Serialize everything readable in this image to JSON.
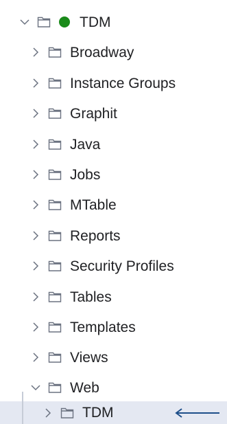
{
  "colors": {
    "status_green": "#1a8a1a",
    "icon_gray": "#6b7280",
    "selected_bg": "#e4e8f2",
    "arrow_blue": "#1d4e89"
  },
  "tree": {
    "root": {
      "label": "TDM",
      "expanded": true,
      "status_color": "#1a8a1a"
    },
    "children": [
      {
        "label": "Broadway",
        "expanded": false
      },
      {
        "label": "Instance Groups",
        "expanded": false
      },
      {
        "label": "Graphit",
        "expanded": false
      },
      {
        "label": "Java",
        "expanded": false
      },
      {
        "label": "Jobs",
        "expanded": false
      },
      {
        "label": "MTable",
        "expanded": false
      },
      {
        "label": "Reports",
        "expanded": false
      },
      {
        "label": "Security Profiles",
        "expanded": false
      },
      {
        "label": "Tables",
        "expanded": false
      },
      {
        "label": "Templates",
        "expanded": false
      },
      {
        "label": "Views",
        "expanded": false
      },
      {
        "label": "Web",
        "expanded": true
      }
    ],
    "web_child": {
      "label": "TDM",
      "expanded": false,
      "selected": true
    }
  },
  "icons": {
    "chevron_collapsed": "chevron-right-icon",
    "chevron_expanded": "chevron-down-icon",
    "folder": "folder-icon",
    "status": "status-dot-icon",
    "pointer": "arrow-left-icon"
  }
}
